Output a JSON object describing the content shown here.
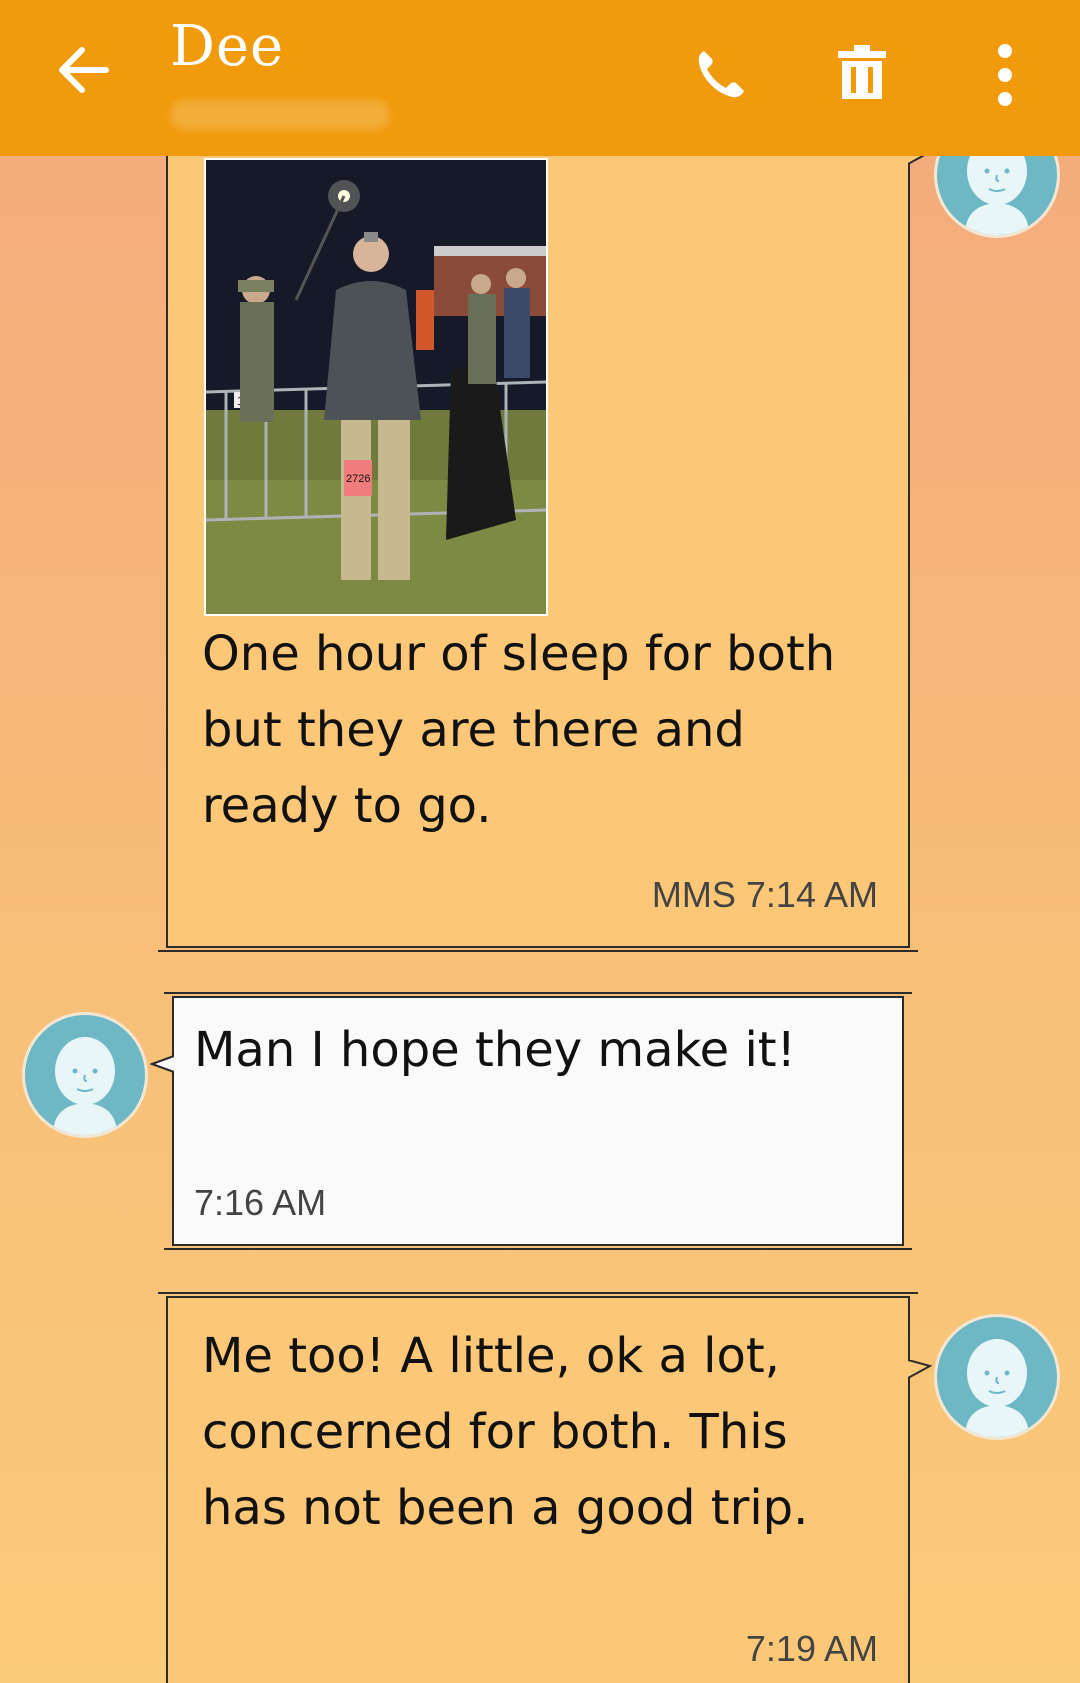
{
  "header": {
    "contact_name": "Dee",
    "back_icon": "arrow-left-icon",
    "call_icon": "phone-icon",
    "delete_icon": "trash-icon",
    "more_icon": "more-vertical-icon",
    "bar_color": "#f09a0c"
  },
  "messages": [
    {
      "direction": "sent",
      "has_image": true,
      "text": "One hour of sleep for both but they are there and ready to go.",
      "type_label": "MMS",
      "time": "7:14 AM"
    },
    {
      "direction": "received",
      "has_image": false,
      "text": "Man I hope they make it!",
      "type_label": "",
      "time": "7:16 AM"
    },
    {
      "direction": "sent",
      "has_image": false,
      "text": "Me too! A little, ok a lot, concerned for both. This has not been a good trip.",
      "type_label": "",
      "time": "7:19 AM"
    }
  ],
  "photo": {
    "bib_number": "2726",
    "sign_number": "15"
  },
  "colors": {
    "sent_bubble": "#fcc877",
    "received_bubble": "#fafafa",
    "avatar": "#6eb8c6"
  }
}
